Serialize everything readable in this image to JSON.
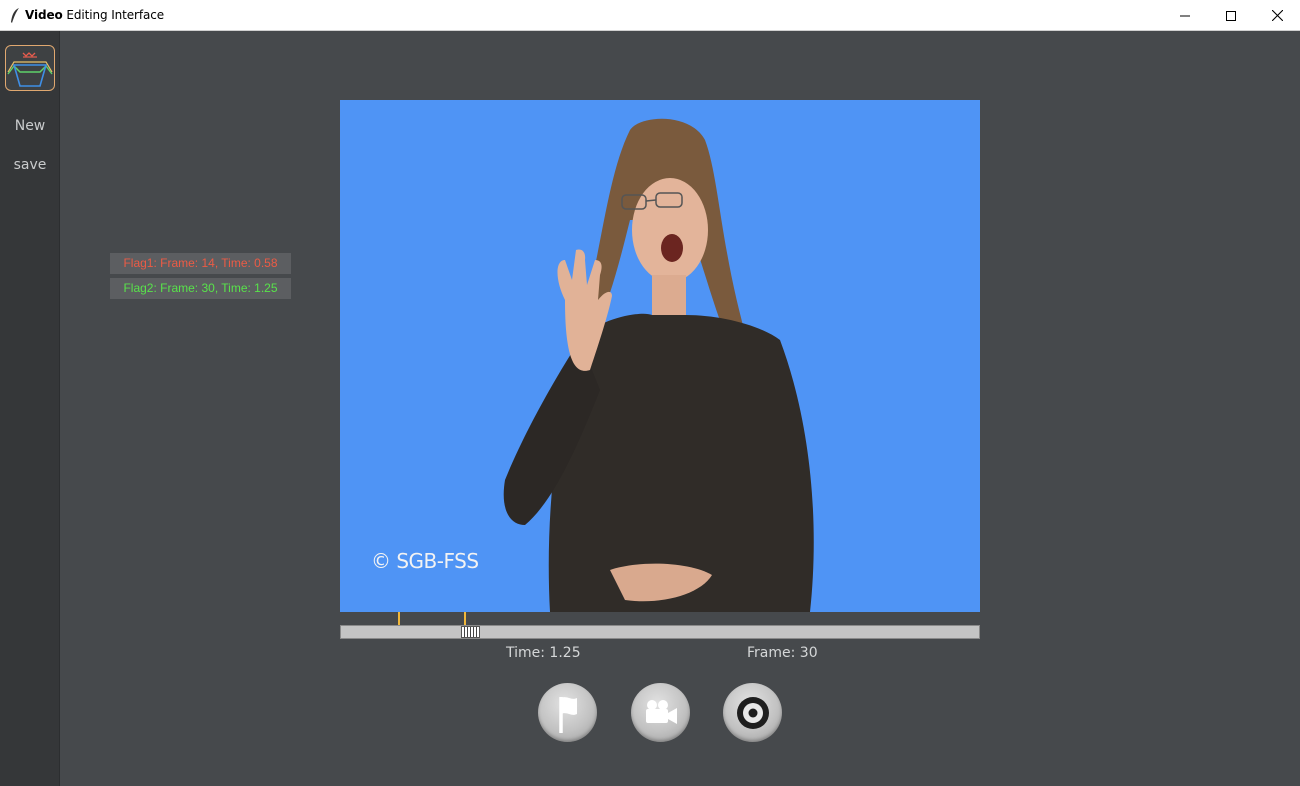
{
  "window": {
    "title_bold": "Video",
    "title_rest": " Editing Interface"
  },
  "sidebar": {
    "logo_icon": "wave-logo-icon",
    "items": [
      {
        "label": "New"
      },
      {
        "label": "save"
      }
    ]
  },
  "flags": [
    {
      "label": "Flag1: Frame: 14, Time: 0.58",
      "color": "#ec5b45"
    },
    {
      "label": "Flag2: Frame: 30, Time: 1.25",
      "color": "#58e34a"
    }
  ],
  "video": {
    "watermark": "© SGB-FSS",
    "background": "#4f94f5"
  },
  "playback": {
    "time_text": "Time: 1.25",
    "frame_text": "Frame: 30"
  },
  "controls": [
    {
      "icon": "flag-icon"
    },
    {
      "icon": "video-camera-icon"
    },
    {
      "icon": "record-icon"
    }
  ],
  "colors": {
    "flag_tick": "#f0b73a",
    "background": "#46494c",
    "sidebar": "#353739"
  }
}
